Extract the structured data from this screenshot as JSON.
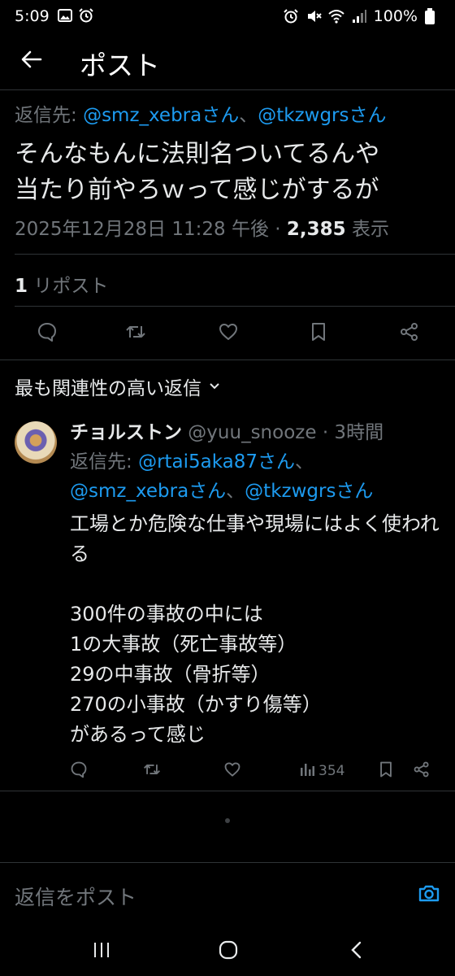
{
  "status_bar": {
    "time": "5:09",
    "battery": "100%"
  },
  "header": {
    "title": "ポスト"
  },
  "tweet": {
    "reply_prefix": "返信先: ",
    "mention1": "@smz_xebraさん",
    "separator": "、",
    "mention2": "@tkzwgrsさん",
    "text_line1": "そんなもんに法則名ついてるんや",
    "text_line2": "当たり前やろｗって感じがするが",
    "timestamp": "2025年12月28日 11:28 午後",
    "meta_sep": " · ",
    "views_count": "2,385",
    "views_label": " 表示",
    "repost_count": "1",
    "repost_label": " リポスト"
  },
  "sort": {
    "label": "最も関連性の高い返信"
  },
  "reply": {
    "name": "チョルストン",
    "handle": " @yuu_snooze · 3時間",
    "reply_prefix": "返信先: ",
    "mention1": "@rtai5aka87さん",
    "sep1": "、",
    "mention2": "@smz_xebraさん",
    "sep2": "、",
    "mention3": "@tkzwgrsさん",
    "text": "工場とか危険な仕事や現場にはよく使われる\n\n300件の事故の中には\n1の大事故（死亡事故等）\n29の中事故（骨折等）\n270の小事故（かすり傷等）\nがあるって感じ",
    "views": "354"
  },
  "compose": {
    "placeholder": "返信をポスト"
  },
  "colors": {
    "accent": "#1d9bf0",
    "muted": "#71767b",
    "text": "#e7e9ea",
    "background": "#000000",
    "divider": "#2f3336"
  }
}
